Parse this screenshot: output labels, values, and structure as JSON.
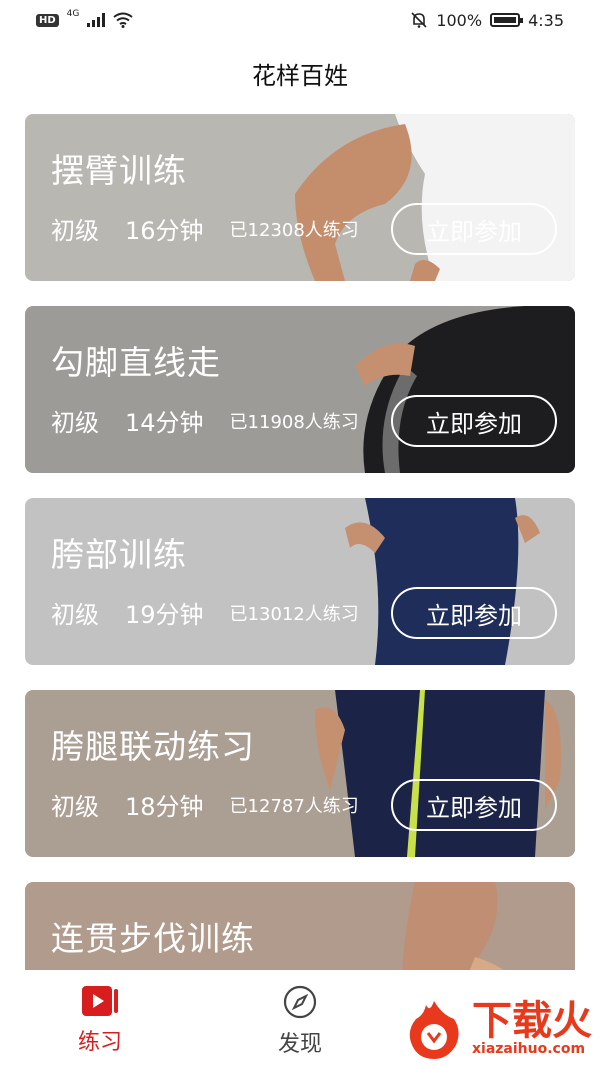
{
  "status_bar": {
    "hd": "HD",
    "network": "4G",
    "battery_percent": "100%",
    "time": "4:35",
    "icons": [
      "signal-icon",
      "wifi-icon",
      "mute-bell-icon",
      "battery-icon"
    ]
  },
  "page": {
    "title": "花样百姓"
  },
  "cards": [
    {
      "title": "摆臂训练",
      "level": "初级",
      "duration": "16分钟",
      "participants": "已12308人练习",
      "button": "立即参加",
      "bg": "#b9b7b2"
    },
    {
      "title": "勾脚直线走",
      "level": "初级",
      "duration": "14分钟",
      "participants": "已11908人练习",
      "button": "立即参加",
      "bg": "#9c9b97"
    },
    {
      "title": "胯部训练",
      "level": "初级",
      "duration": "19分钟",
      "participants": "已13012人练习",
      "button": "立即参加",
      "bg": "#c2c2c3"
    },
    {
      "title": "胯腿联动练习",
      "level": "初级",
      "duration": "18分钟",
      "participants": "已12787人练习",
      "button": "立即参加",
      "bg": "#ab9e93"
    },
    {
      "title": "连贯步伐训练",
      "level": "",
      "duration": "",
      "participants": "",
      "button": "",
      "bg": "#b09b8d"
    }
  ],
  "bottom_nav": {
    "items": [
      {
        "label": "练习",
        "icon": "video-play-icon",
        "active": true
      },
      {
        "label": "发现",
        "icon": "compass-icon",
        "active": false
      }
    ]
  },
  "watermark": {
    "brand": "下载火",
    "url": "xiazaihuo.com"
  },
  "colors": {
    "accent": "#d71d1d",
    "watermark": "#e8391d"
  }
}
